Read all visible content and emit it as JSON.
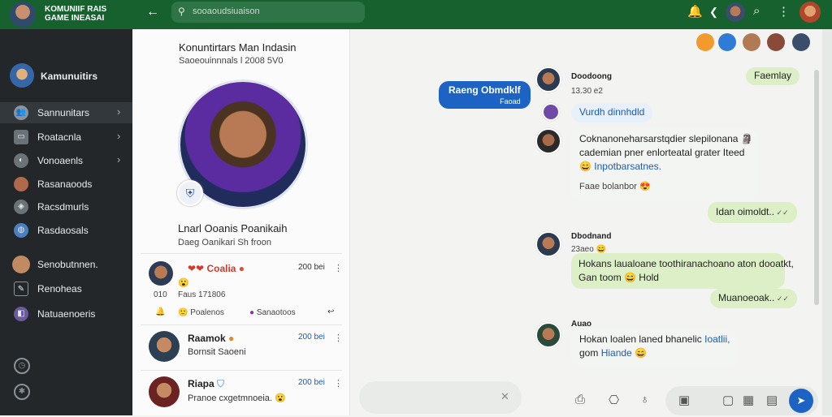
{
  "topbar": {
    "brand_line1": "KOMUNIIF RAIS",
    "brand_line2": "GAME INEASAI",
    "search_placeholder": "sooaoudsiuaison"
  },
  "sidebar": {
    "community": "Kamunuitirs",
    "items": [
      {
        "label": "Sannunitars",
        "icon": "people-icon",
        "chev": true
      },
      {
        "label": "Roatacnla",
        "icon": "chat-icon",
        "chev": true
      },
      {
        "label": "Vonoaenls",
        "icon": "megaphone-icon",
        "chev": true
      },
      {
        "label": "Rasanaoods",
        "icon": "avatar-icon",
        "chev": false
      },
      {
        "label": "Racsdmurls",
        "icon": "tag-icon",
        "chev": false
      },
      {
        "label": "Rasdaosals",
        "icon": "globe-icon",
        "chev": false
      },
      {
        "label": "Senobutnnen.",
        "icon": "avatar-icon",
        "chev": false
      },
      {
        "label": "Renoheas",
        "icon": "edit-icon",
        "chev": false
      },
      {
        "label": "Natuaenoeris",
        "icon": "group-icon",
        "chev": false
      }
    ]
  },
  "profile": {
    "title": "Konuntirtars Man Indasin",
    "subtitle": "Saoeouinnnals l 2008 5V0",
    "name": "Lnarl Ooanis Poanikaih",
    "handle": "Daeg Oanikari Sh froon"
  },
  "conversations": [
    {
      "name": "Coalia",
      "time": "200 bei",
      "preview": "😮",
      "meta": "Faus 171806",
      "count": "010",
      "action1": "Poalenos",
      "action2": "Sanaotoos"
    },
    {
      "name": "Raamok",
      "time": "200 bei",
      "preview": "Bornsit Saoeni"
    },
    {
      "name": "Riapa",
      "time": "200 bei",
      "preview": "Pranoe cxgetmnoeia. 😮"
    }
  ],
  "chat": {
    "header_avatars": [
      "avatar-1",
      "avatar-2",
      "avatar-3",
      "avatar-4",
      "avatar-5"
    ],
    "messages": [
      {
        "text": "Raeng Obmdklf",
        "sub": "Faoad",
        "style": "dark"
      },
      {
        "sender": "Doodoong",
        "time": "13.30 e2"
      },
      {
        "text": "Faemlay",
        "style": "green"
      },
      {
        "text": "Vurdh dinnhdld",
        "style": "blue"
      },
      {
        "text1": "Coknanoneharsarstqdier slepilonana 🗿",
        "text2": "cademian pner enlorteatal grater Iteed",
        "text3": "Inpotbarsatnes.",
        "time": "Faae bolanbor 😍",
        "style": "white"
      },
      {
        "text": "Idan oimoldt..",
        "style": "green"
      },
      {
        "sender": "Dbodnand",
        "time": "23aeo 😄"
      },
      {
        "text1": "Hokans laualoane toothiranachoano aton dooatkt,",
        "text2": "Gan toom 😄 Hold",
        "style": "green"
      },
      {
        "text": "Muanoeoak..",
        "style": "green"
      },
      {
        "sender": "Auao",
        "text1": "Hokan loalen laned bhanelic",
        "text1b": "Ioatlii,",
        "text2": "gom",
        "text2b": "Hiande",
        "style": "white"
      }
    ]
  }
}
